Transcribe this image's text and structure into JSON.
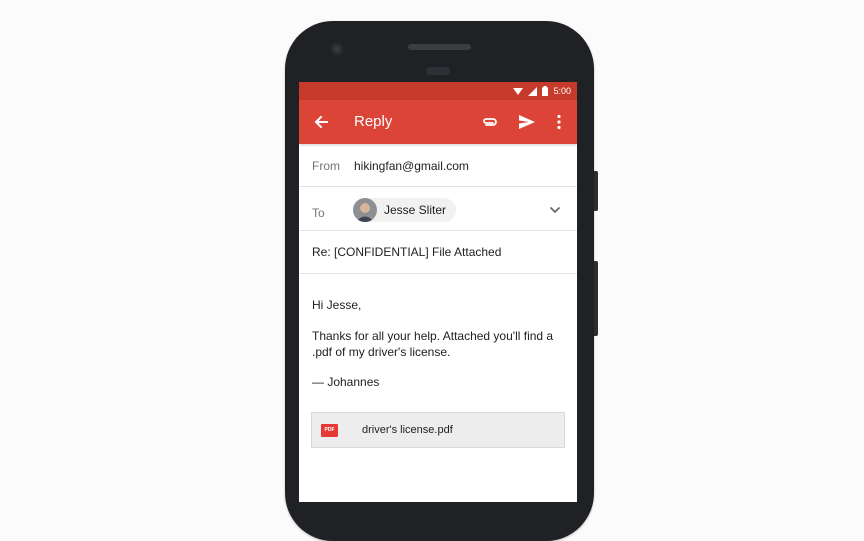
{
  "status_bar": {
    "time": "5:00",
    "icons": [
      "wifi-icon",
      "signal-icon",
      "battery-icon"
    ]
  },
  "app_bar": {
    "title": "Reply",
    "icons": [
      "back-arrow-icon",
      "attach-icon",
      "send-icon",
      "more-vert-icon"
    ]
  },
  "compose": {
    "from_label": "From",
    "from_value": "hikingfan@gmail.com",
    "to_label": "To",
    "to_recipient": "Jesse Sliter",
    "subject": "Re: [CONFIDENTIAL] File Attached",
    "greeting": "Hi Jesse,",
    "message": "Thanks for all your help. Attached you'll find a .pdf of my driver's license.",
    "signature": "— Johannes"
  },
  "attachment": {
    "badge": "PDF",
    "file_name": "driver's license.pdf"
  },
  "colors": {
    "app_bar": "#db4437",
    "status_bar": "#c63a2c",
    "phone_body": "#1f2124",
    "pdf_badge": "#e53935"
  }
}
